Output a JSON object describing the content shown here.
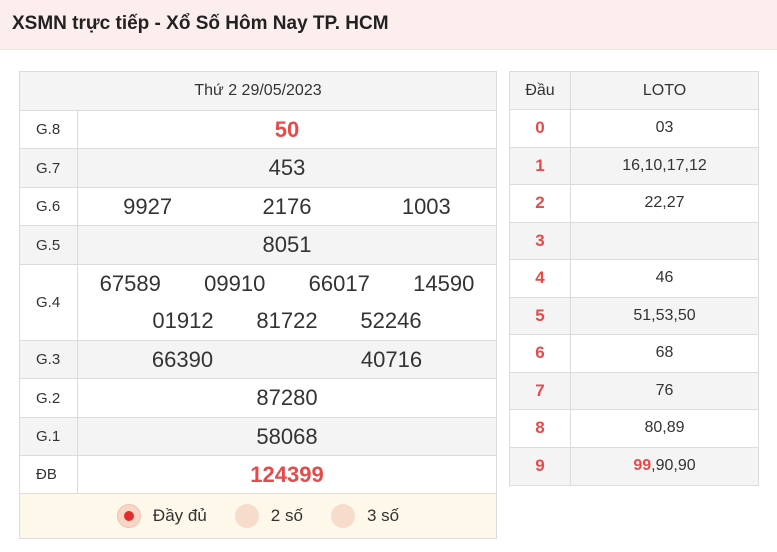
{
  "header": {
    "title": "XSMN trực tiếp - Xổ Số Hôm Nay TP. HCM"
  },
  "results": {
    "date": "Thứ 2 29/05/2023",
    "prizes": [
      {
        "label": "G.8",
        "numbers": [
          "50"
        ]
      },
      {
        "label": "G.7",
        "numbers": [
          "453"
        ]
      },
      {
        "label": "G.6",
        "numbers": [
          "9927",
          "2176",
          "1003"
        ]
      },
      {
        "label": "G.5",
        "numbers": [
          "8051"
        ]
      },
      {
        "label": "G.4",
        "numbers": [
          "67589",
          "09910",
          "66017",
          "14590",
          "01912",
          "81722",
          "52246"
        ]
      },
      {
        "label": "G.3",
        "numbers": [
          "66390",
          "40716"
        ]
      },
      {
        "label": "G.2",
        "numbers": [
          "87280"
        ]
      },
      {
        "label": "G.1",
        "numbers": [
          "58068"
        ]
      },
      {
        "label": "ĐB",
        "numbers": [
          "124399"
        ]
      }
    ]
  },
  "options": [
    {
      "label": "Đầy đủ",
      "selected": true
    },
    {
      "label": "2 số",
      "selected": false
    },
    {
      "label": "3 số",
      "selected": false
    }
  ],
  "loto": {
    "head_label": "Đầu",
    "loto_label": "LOTO",
    "rows": [
      {
        "head": "0",
        "values": "03"
      },
      {
        "head": "1",
        "values": "16,10,17,12"
      },
      {
        "head": "2",
        "values": "22,27"
      },
      {
        "head": "3",
        "values": ""
      },
      {
        "head": "4",
        "values": "46"
      },
      {
        "head": "5",
        "values": "51,53,50"
      },
      {
        "head": "6",
        "values": "68"
      },
      {
        "head": "7",
        "values": "76"
      },
      {
        "head": "8",
        "values": "80,89"
      },
      {
        "head": "9",
        "values_highlight": "99",
        "values_rest": ",90,90"
      }
    ]
  },
  "colors": {
    "accent": "#e54b4b",
    "header_bg": "#fdeeee",
    "option_bg": "#fdf8ea"
  }
}
